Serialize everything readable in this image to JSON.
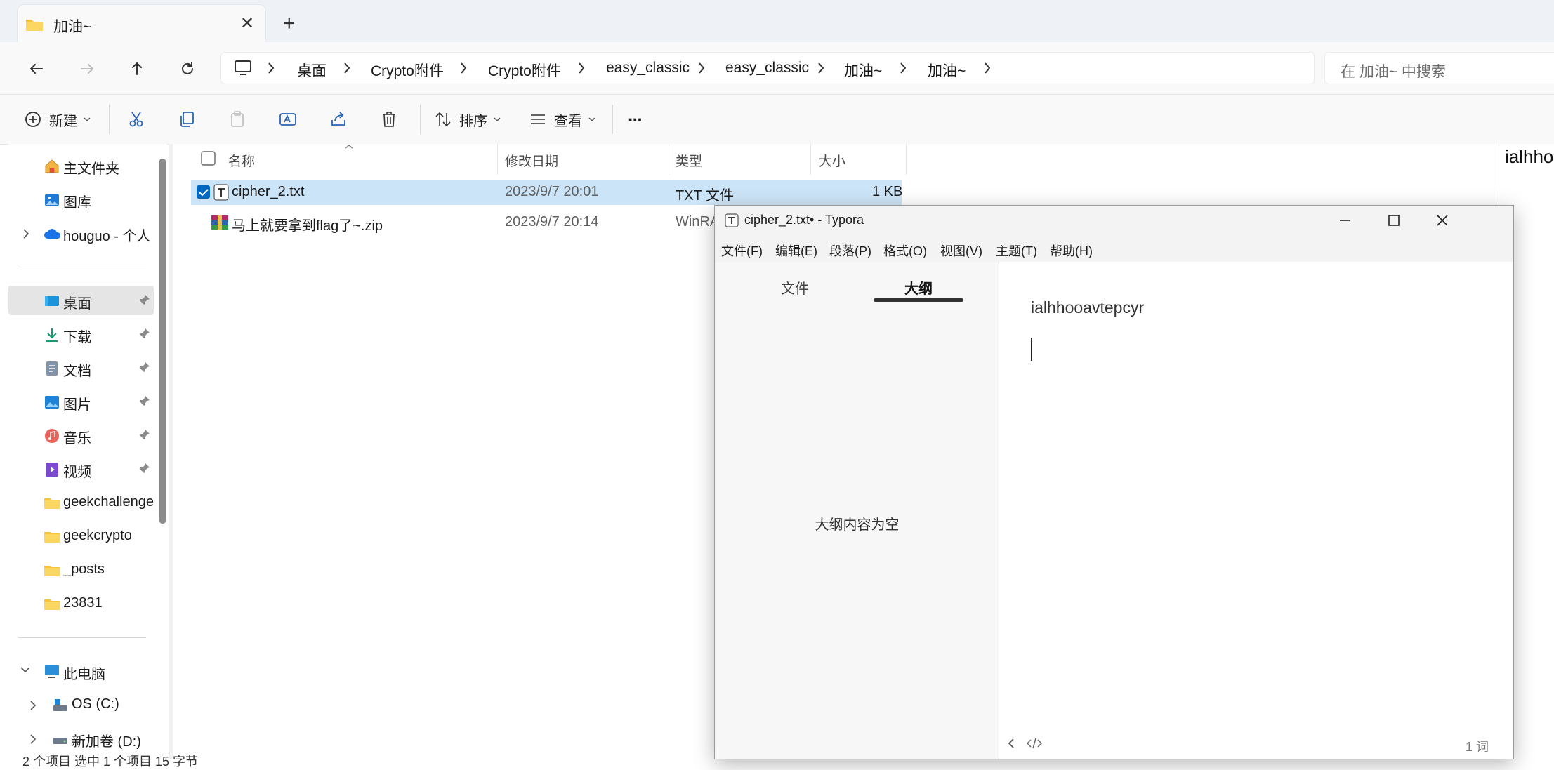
{
  "explorer": {
    "tab_title": "加油~",
    "new_tab_symbol": "+",
    "close_symbol": "✕",
    "breadcrumb": [
      "桌面",
      "Crypto附件",
      "Crypto附件",
      "easy_classic",
      "easy_classic",
      "加油~",
      "加油~"
    ],
    "search_placeholder": "在 加油~ 中搜索",
    "commands": {
      "new": "新建",
      "sort": "排序",
      "view": "查看",
      "more": "···"
    },
    "sidebar": {
      "home": "主文件夹",
      "gallery": "图库",
      "onedrive": "houguo - 个人",
      "desktop": "桌面",
      "downloads": "下载",
      "documents": "文档",
      "pictures": "图片",
      "music": "音乐",
      "videos": "视频",
      "folder1": "geekchallenge",
      "folder2": "geekcrypto",
      "folder3": "_posts",
      "folder4": "23831",
      "this_pc": "此电脑",
      "drive_c": "OS (C:)",
      "drive_d": "新加卷 (D:)"
    },
    "columns": {
      "name": "名称",
      "modified": "修改日期",
      "type": "类型",
      "size": "大小"
    },
    "files": [
      {
        "name": "cipher_2.txt",
        "modified": "2023/9/7 20:01",
        "type": "TXT 文件",
        "size": "1 KB"
      },
      {
        "name": "马上就要拿到flag了~.zip",
        "modified": "2023/9/7 20:14",
        "type": "WinRA",
        "size": ""
      }
    ],
    "status": "2 个项目    选中 1 个项目  15 字节",
    "preview_text": "ialhho"
  },
  "typora": {
    "title": "cipher_2.txt• - Typora",
    "menus": [
      "文件(F)",
      "编辑(E)",
      "段落(P)",
      "格式(O)",
      "视图(V)",
      "主题(T)",
      "帮助(H)"
    ],
    "tab_file": "文件",
    "tab_outline": "大纲",
    "outline_empty": "大纲内容为空",
    "document_text": "ialhhooavtepcyr",
    "word_count": "1 词"
  },
  "colors": {
    "accent": "#0067c0",
    "selection": "#cce4f7",
    "folder": "#f8c33a"
  }
}
